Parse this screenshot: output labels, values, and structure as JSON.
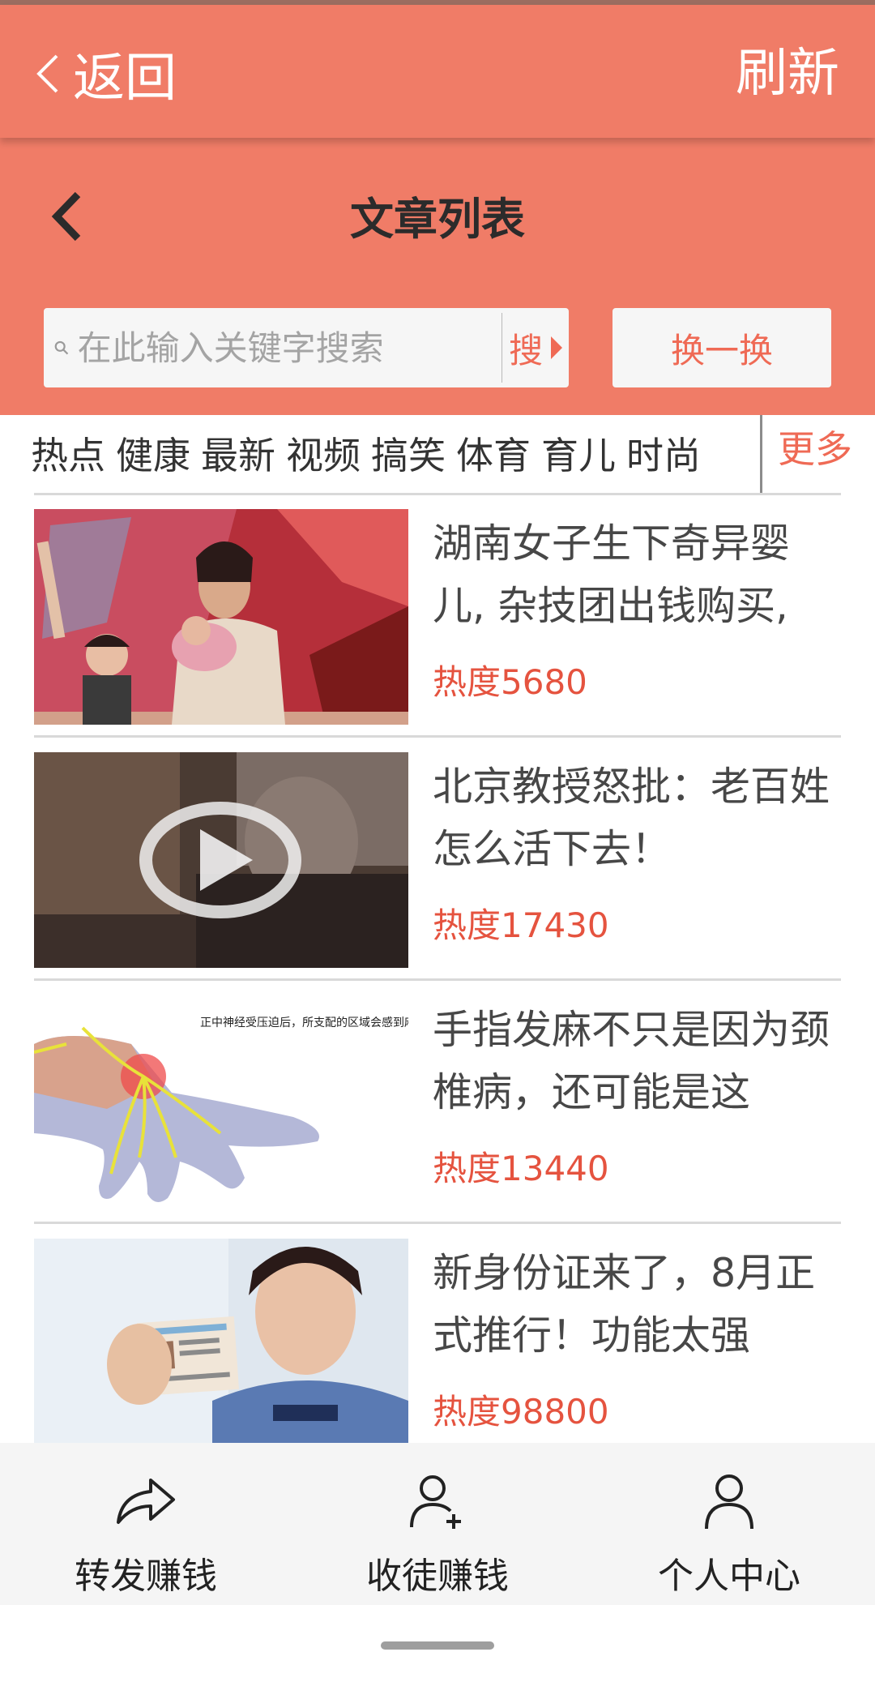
{
  "colors": {
    "accent": "#f07c67",
    "heat": "#e5533f",
    "button_text": "#ef6a55"
  },
  "appbar": {
    "back_label": "返回",
    "refresh_label": "刷新"
  },
  "header": {
    "title": "文章列表"
  },
  "search": {
    "placeholder": "在此输入关键字搜索",
    "value": "",
    "button_label": "搜"
  },
  "swap_button": {
    "label": "换一换"
  },
  "categories": [
    "热点",
    "健康",
    "最新",
    "视频",
    "搞笑",
    "体育",
    "育儿",
    "时尚"
  ],
  "more_label": "更多",
  "articles": [
    {
      "title": "湖南女子生下奇异婴儿, 杂技团出钱购买,",
      "heat": "热度5680",
      "thumb": "woman-with-baby-on-stage"
    },
    {
      "title": "北京教授怒批：老百姓怎么活下去！",
      "heat": "热度17430",
      "thumb": "video-play-overlay"
    },
    {
      "title": "手指发麻不只是因为颈椎病，还可能是这",
      "heat": "热度13440",
      "thumb": "hand-nerve-diagram",
      "thumb_caption": "正中神经受压迫后，所支配的区域会感到麻木或疼痛。"
    },
    {
      "title": "新身份证来了，8月正式推行！功能太强",
      "heat": "热度98800",
      "thumb": "police-officer-with-id-card"
    }
  ],
  "tabs": [
    {
      "label": "转发赚钱",
      "icon": "share-arrow-icon"
    },
    {
      "label": "收徒赚钱",
      "icon": "add-user-icon"
    },
    {
      "label": "个人中心",
      "icon": "person-icon"
    }
  ]
}
